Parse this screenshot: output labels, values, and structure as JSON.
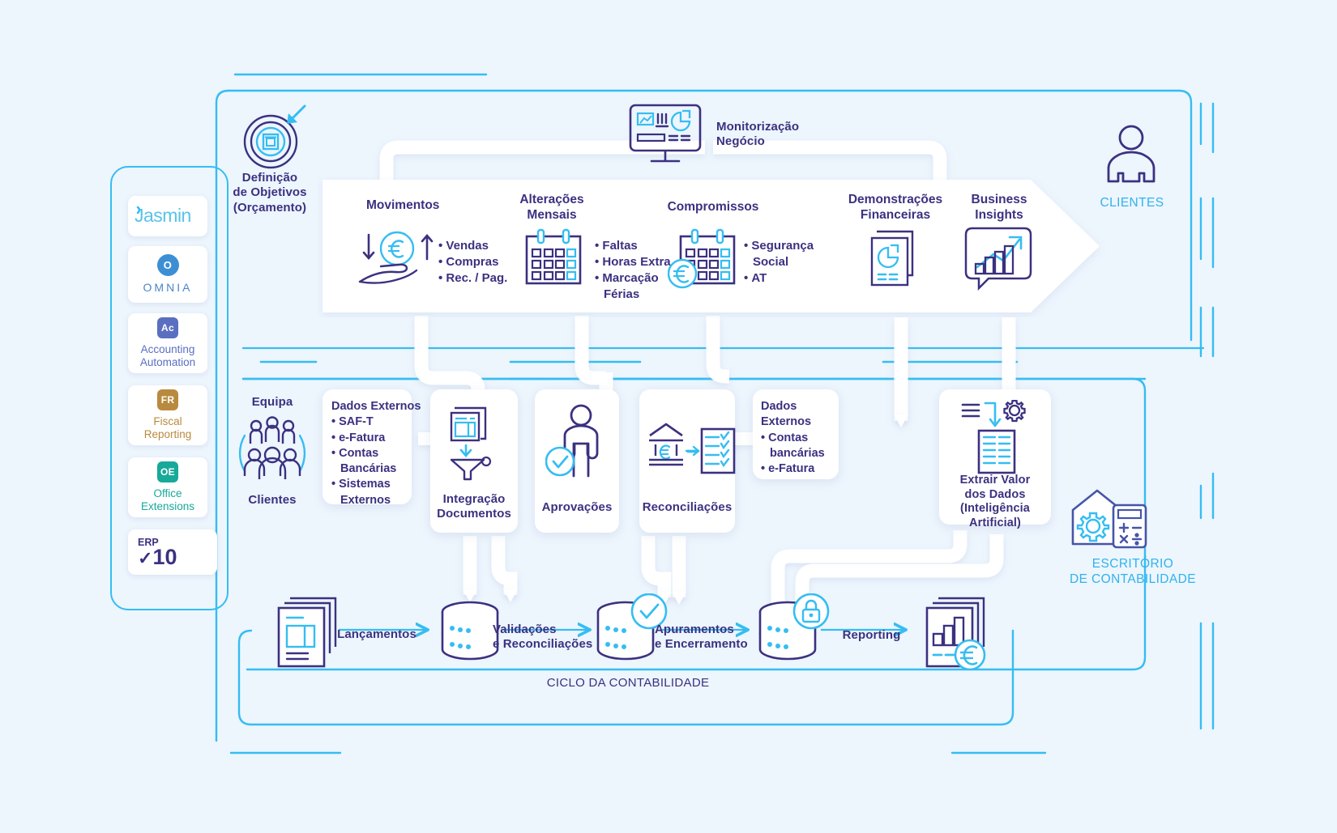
{
  "meta": {
    "title": "Ciclo da Contabilidade - Diagrama",
    "colors": {
      "background": "#edf5fd",
      "cyan": "#35bdf2",
      "indigo": "#3b3180",
      "white": "#ffffff",
      "pipe": "#ffffff"
    }
  },
  "left_rail": {
    "products": [
      {
        "id": "jasmin",
        "name": "Jasmin",
        "wordmark": "Jasmin",
        "badge": "",
        "badge_color": "#35bdf2",
        "text_color": "#35bdf2"
      },
      {
        "id": "omnia",
        "name": "OMNIA",
        "wordmark": "OMNIA",
        "badge": "O",
        "badge_color": "#3d8fd4",
        "text_color": "#4a86c8"
      },
      {
        "id": "accounting-automation",
        "name": "Accounting Automation",
        "wordmark": "Accounting\nAutomation",
        "badge": "Ac",
        "badge_color": "#5a6fc0",
        "text_color": "#5a6fc0"
      },
      {
        "id": "fiscal-reporting",
        "name": "Fiscal Reporting",
        "wordmark": "Fiscal\nReporting",
        "badge": "FR",
        "badge_color": "#b98a3e",
        "text_color": "#b98a3e"
      },
      {
        "id": "office-extensions",
        "name": "Office Extensions",
        "wordmark": "Office\nExtensions",
        "badge": "OE",
        "badge_color": "#17a99a",
        "text_color": "#17a99a"
      },
      {
        "id": "erp",
        "name": "ERP v10",
        "wordmark": "10",
        "badge": "",
        "badge_color": "#3b3180",
        "text_color": "#3b3180",
        "eyebrow": "ERP"
      }
    ]
  },
  "objectives": {
    "icon": "target-icon",
    "label_lines": [
      "Definição",
      "de Objetivos",
      "(Orçamento)"
    ]
  },
  "monitoring": {
    "icon": "dashboard-monitor-icon",
    "label_lines": [
      "Monitorização",
      "Negócio"
    ]
  },
  "banner": {
    "items": [
      {
        "id": "movimentos",
        "title": "Movimentos",
        "icon": "cash-flow-hand-euro-icon",
        "bullets": [
          "Vendas",
          "Compras",
          "Rec. / Pag."
        ]
      },
      {
        "id": "alteracoes-mensais",
        "title_lines": [
          "Alterações",
          "Mensais"
        ],
        "icon": "calendar-icon",
        "bullets": [
          "Faltas",
          "Horas Extra",
          "Marcação"
        ],
        "bullet_cont": "Férias"
      },
      {
        "id": "compromissos",
        "title": "Compromissos",
        "icon": "calendar-euro-icon",
        "bullets": [
          "Segurança",
          "AT"
        ],
        "bullet_sub": "Social"
      },
      {
        "id": "demonstracoes-financeiras",
        "title_lines": [
          "Demonstrações",
          "Financeiras"
        ],
        "icon": "financial-statements-icon",
        "bullets": []
      },
      {
        "id": "business-insights",
        "title_lines": [
          "Business",
          "Insights"
        ],
        "icon": "growth-chart-bubble-icon",
        "bullets": []
      }
    ]
  },
  "actors": {
    "clientes": {
      "icon": "person-icon",
      "label": "CLIENTES"
    },
    "escritorio": {
      "icon": "office-calculator-gear-icon",
      "label_lines": [
        "ESCRITÓRIO",
        "DE CONTABILIDADE"
      ]
    }
  },
  "team": {
    "icon": "people-group-icon",
    "top_label": "Equipa",
    "bottom_label": "Clientes"
  },
  "mid_row": {
    "dados_externos_left": {
      "title": "Dados Externos",
      "bullets": [
        "SAF-T",
        "e-Fatura",
        "Contas",
        "Sistemas"
      ],
      "bullet_conts": {
        "Contas": "Bancárias",
        "Sistemas": "Externos"
      }
    },
    "cards": [
      {
        "id": "integracao-documentos",
        "icon": "document-funnel-icon",
        "label_lines": [
          "Integração",
          "Documentos"
        ]
      },
      {
        "id": "aprovacoes",
        "icon": "person-check-icon",
        "label_lines": [
          "Aprovações"
        ]
      },
      {
        "id": "reconciliacoes",
        "icon": "bank-checklist-icon",
        "label_lines": [
          "Reconciliações"
        ]
      },
      {
        "id": "extrair-valor",
        "icon": "ai-data-extract-icon",
        "label_lines": [
          "Extrair Valor",
          "dos Dados",
          "(Inteligência Artificial)"
        ]
      }
    ],
    "dados_externos_right": {
      "title_lines": [
        "Dados",
        "Externos"
      ],
      "bullets": [
        "Contas",
        "e-Fatura"
      ],
      "bullet_sub": "bancárias"
    }
  },
  "cycle": {
    "footer_label": "CICLO DA CONTABILIDADE",
    "steps": [
      {
        "id": "documentos",
        "icon": "documents-stack-icon"
      },
      {
        "id": "lancamentos",
        "label_lines": [
          "Lançamentos"
        ],
        "arrow": true
      },
      {
        "id": "db1",
        "icon": "database-icon"
      },
      {
        "id": "validacoes",
        "label_lines": [
          "Validações",
          "e Reconciliações"
        ],
        "arrow": true
      },
      {
        "id": "db2",
        "icon": "database-check-icon"
      },
      {
        "id": "apuramentos",
        "label_lines": [
          "Apuramentos",
          "e Encerramento"
        ],
        "arrow": true
      },
      {
        "id": "db3",
        "icon": "database-lock-icon"
      },
      {
        "id": "reporting",
        "label_lines": [
          "Reporting"
        ],
        "arrow": true
      },
      {
        "id": "relatorio",
        "icon": "report-euro-icon"
      }
    ]
  }
}
